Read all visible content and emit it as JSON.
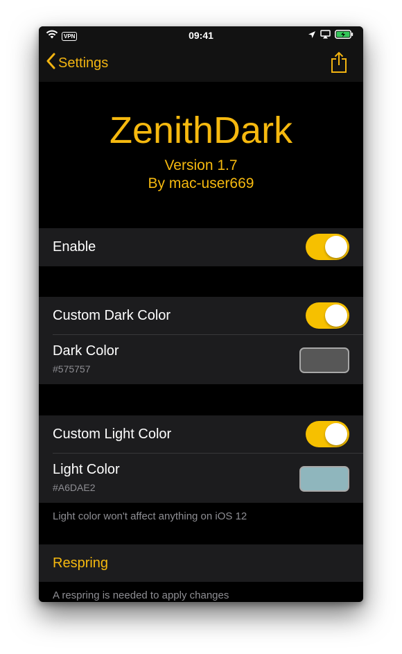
{
  "status_bar": {
    "time": "09:41",
    "vpn_label": "VPN"
  },
  "nav": {
    "back_label": "Settings"
  },
  "header": {
    "title": "ZenithDark",
    "version": "Version 1.7",
    "author": "By mac-user669"
  },
  "cells": {
    "enable": {
      "label": "Enable",
      "on": true
    },
    "custom_dark": {
      "label": "Custom Dark Color",
      "on": true
    },
    "dark_color": {
      "label": "Dark Color",
      "hex": "#575757"
    },
    "custom_light": {
      "label": "Custom Light Color",
      "on": true
    },
    "light_color": {
      "label": "Light Color",
      "hex": "#A6DAE2"
    },
    "light_footer": "Light color won't affect anything on iOS 12",
    "respring": {
      "label": "Respring"
    },
    "respring_footer": "A respring is needed to apply changes"
  },
  "colors": {
    "accent": "#F6B90F",
    "toggle_on": "#F6C000",
    "cell_bg": "#1C1C1E",
    "dark_swatch": "#575757",
    "light_swatch": "#8FB6BD"
  }
}
